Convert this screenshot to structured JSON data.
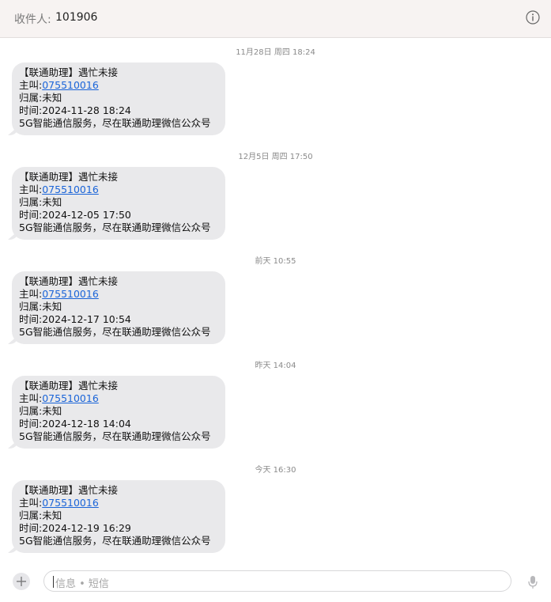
{
  "header": {
    "to_label": "收件人:",
    "recipient": "101906",
    "info_icon": "info-icon"
  },
  "messages": [
    {
      "timestamp": "11月28日 周四 18:24",
      "title": "【联通助理】遇忙未接",
      "caller_prefix": "主叫:",
      "caller_number": "075510016",
      "location": "归属:未知",
      "time": "时间:2024-11-28 18:24",
      "footer": "5G智能通信服务，尽在联通助理微信公众号"
    },
    {
      "timestamp": "12月5日 周四 17:50",
      "title": "【联通助理】遇忙未接",
      "caller_prefix": "主叫:",
      "caller_number": "075510016",
      "location": "归属:未知",
      "time": "时间:2024-12-05 17:50",
      "footer": "5G智能通信服务，尽在联通助理微信公众号"
    },
    {
      "timestamp": "前天 10:55",
      "title": "【联通助理】遇忙未接",
      "caller_prefix": "主叫:",
      "caller_number": "075510016",
      "location": "归属:未知",
      "time": "时间:2024-12-17 10:54",
      "footer": "5G智能通信服务，尽在联通助理微信公众号"
    },
    {
      "timestamp": "昨天 14:04",
      "title": "【联通助理】遇忙未接",
      "caller_prefix": "主叫:",
      "caller_number": "075510016",
      "location": "归属:未知",
      "time": "时间:2024-12-18 14:04",
      "footer": "5G智能通信服务，尽在联通助理微信公众号"
    },
    {
      "timestamp": "今天 16:30",
      "title": "【联通助理】遇忙未接",
      "caller_prefix": "主叫:",
      "caller_number": "075510016",
      "location": "归属:未知",
      "time": "时间:2024-12-19 16:29",
      "footer": "5G智能通信服务，尽在联通助理微信公众号"
    }
  ],
  "composer": {
    "placeholder": "信息 • 短信",
    "add_icon": "plus-icon",
    "voice_icon": "microphone-icon"
  },
  "colors": {
    "bubble": "#e9e9eb",
    "link": "#1a64d8",
    "header_bg": "#f7f3f2"
  }
}
